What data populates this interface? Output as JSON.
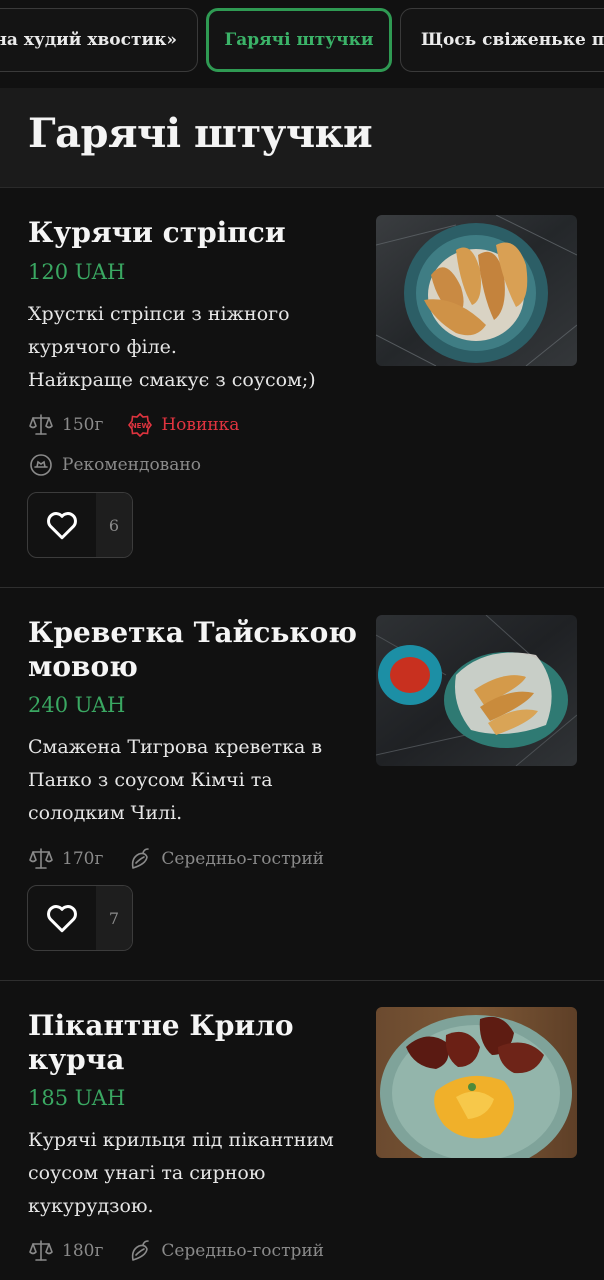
{
  "tabs": [
    {
      "label": "на худий хвостик»",
      "active": false
    },
    {
      "label": "Гарячі штучки",
      "active": true
    },
    {
      "label": "Щось свіженьке по",
      "active": false
    }
  ],
  "section": {
    "title": "Гарячі штучки"
  },
  "colors": {
    "accent": "#3bb368",
    "new_badge": "#e0343f",
    "background": "#111111"
  },
  "items": [
    {
      "name": "Курячи стріпси",
      "price": "120 UAH",
      "description": "Хрусткі стріпси з ніжного курячого філе.\nНайкраще смакує з соусом;)",
      "weight": "150г",
      "weight_icon": "scale-icon",
      "badge": "Новинка",
      "badge_icon": "new-icon",
      "tag": "Рекомендовано",
      "tag_icon": "recommended-icon",
      "likes": "6",
      "image": "chicken-strips-photo"
    },
    {
      "name": "Креветка Тайською мовою",
      "price": "240 UAH",
      "description": "Смажена Тигрова креветка в Панко з соусом Кімчі та солодким Чилі.",
      "weight": "170г",
      "weight_icon": "scale-icon",
      "tag": "Середньо-гострий",
      "tag_icon": "chili-icon",
      "likes": "7",
      "image": "shrimp-photo"
    },
    {
      "name": "Пікантне Крило курча",
      "price": "185 UAH",
      "description": "Курячі крильця під пікантним соусом унагі та сирною кукурудзою.",
      "weight": "180г",
      "weight_icon": "scale-icon",
      "tag": "Середньо-гострий",
      "tag_icon": "chili-icon",
      "image": "chicken-wings-photo"
    }
  ]
}
